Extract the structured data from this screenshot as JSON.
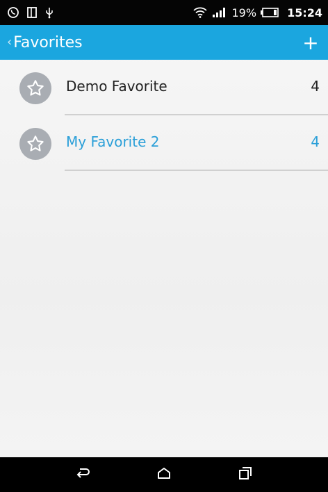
{
  "status_bar": {
    "battery_percent": "19%",
    "time": "15:24",
    "icons": [
      "whatsapp-icon",
      "notification-icon",
      "usb-icon",
      "wifi-icon",
      "signal-icon",
      "battery-icon"
    ]
  },
  "app_bar": {
    "title": "Favorites",
    "add_label": "+",
    "accent_color": "#1ba6df"
  },
  "favorites": [
    {
      "label": "Demo Favorite",
      "count": "4",
      "icon": "star-icon"
    },
    {
      "label": "My Favorite 2",
      "count": "4",
      "icon": "star-icon",
      "highlighted": true,
      "highlight_color": "#2a9fd8"
    }
  ],
  "nav_bar": {
    "buttons": [
      "back-icon",
      "home-icon",
      "recents-icon"
    ]
  }
}
